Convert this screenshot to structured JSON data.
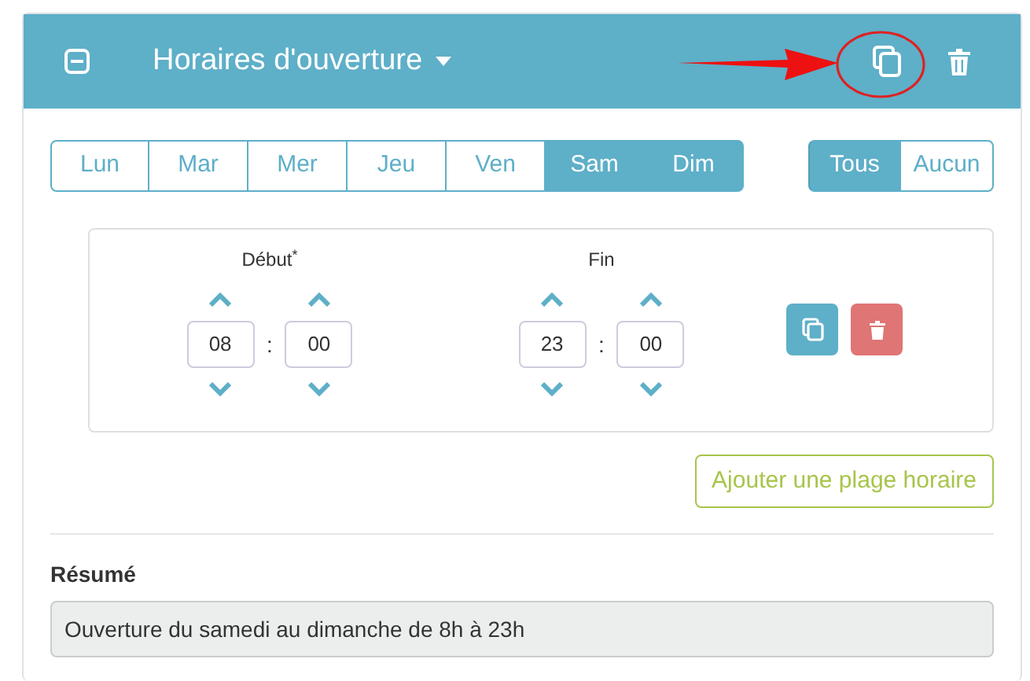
{
  "header": {
    "title": "Horaires d'ouverture",
    "collapsed": false
  },
  "days": [
    {
      "label": "Lun",
      "selected": false
    },
    {
      "label": "Mar",
      "selected": false
    },
    {
      "label": "Mer",
      "selected": false
    },
    {
      "label": "Jeu",
      "selected": false
    },
    {
      "label": "Ven",
      "selected": false
    },
    {
      "label": "Sam",
      "selected": true
    },
    {
      "label": "Dim",
      "selected": true
    }
  ],
  "select_all": [
    {
      "label": "Tous",
      "selected": true
    },
    {
      "label": "Aucun",
      "selected": false
    }
  ],
  "ranges": [
    {
      "start": {
        "label": "Début$^{*}$",
        "hours": "08",
        "separator": ":",
        "minutes": "00"
      },
      "end": {
        "label": "Fin",
        "hours": "23",
        "separator": ":",
        "minutes": "00"
      }
    }
  ],
  "add_button": "Ajouter une plage horaire",
  "summary": {
    "label": "Résumé",
    "value": "Ouverture du samedi au dimanche de 8h à 23h"
  }
}
